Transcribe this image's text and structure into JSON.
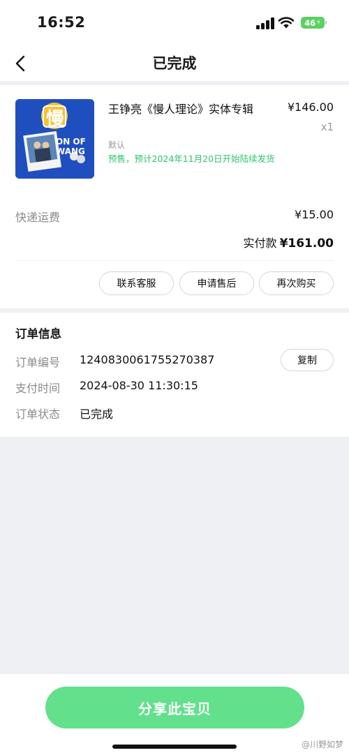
{
  "status_bar": {
    "time": "16:52",
    "battery": "46"
  },
  "nav": {
    "title": "已完成"
  },
  "order": {
    "product": {
      "name": "王铮亮《慢人理论》实体专辑",
      "price": "¥146.00",
      "quantity": "x1",
      "variant": "默认",
      "presale_note": "预售，预计2024年11月20日开始陆续发货",
      "image_text": {
        "char": "慢",
        "line1": "ON OF",
        "line2": "WANG"
      }
    },
    "shipping_label": "快递运费",
    "shipping_fee": "¥15.00",
    "paid_label": "实付款",
    "paid_amount": "¥161.00",
    "actions": [
      "联系客服",
      "申请售后",
      "再次购买"
    ]
  },
  "info": {
    "title": "订单信息",
    "rows": [
      {
        "label": "订单编号",
        "value": "1240830061755270387"
      },
      {
        "label": "支付时间",
        "value": "2024-08-30 11:30:15"
      },
      {
        "label": "订单状态",
        "value": "已完成"
      }
    ],
    "copy_label": "复制"
  },
  "bottom": {
    "share_label": "分享此宝贝"
  },
  "watermark": "@川野如梦",
  "colors": {
    "accent_green": "#62e08c",
    "presale_green": "#2fc46c",
    "battery_green": "#5ccf62",
    "cover_blue": "#1f4fbf"
  }
}
